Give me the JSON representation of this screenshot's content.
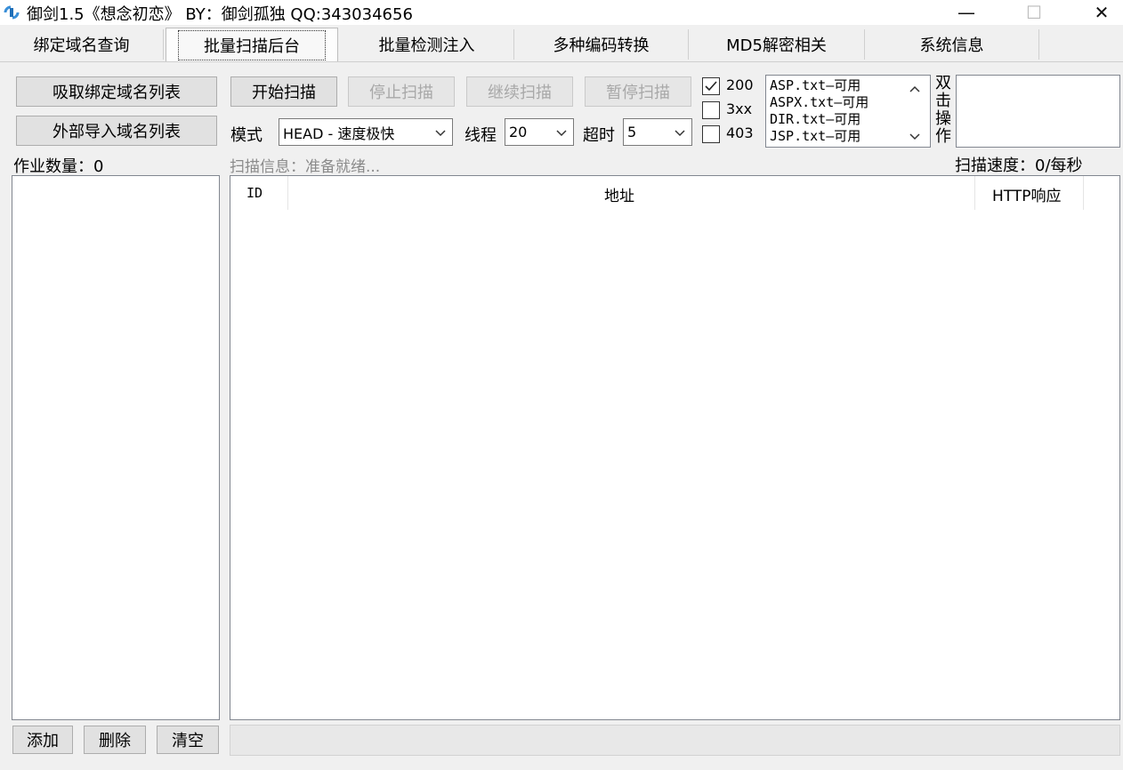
{
  "window": {
    "title": "御剑1.5《想念初恋》 BY：御剑孤独 QQ:343034656",
    "icon": "sword-app-icon",
    "controls": {
      "minimize": "—",
      "maximize": "☐",
      "close": "✕"
    }
  },
  "tabs": [
    {
      "label": "绑定域名查询",
      "active": false
    },
    {
      "label": "批量扫描后台",
      "active": true
    },
    {
      "label": "批量检测注入",
      "active": false
    },
    {
      "label": "多种编码转换",
      "active": false
    },
    {
      "label": "MD5解密相关",
      "active": false
    },
    {
      "label": "系统信息",
      "active": false
    }
  ],
  "left": {
    "fetch_button": "吸取绑定域名列表",
    "import_button": "外部导入域名列表",
    "job_count": "作业数量：0",
    "add_button": "添加",
    "delete_button": "删除",
    "clear_button": "清空"
  },
  "toolbar": {
    "start": "开始扫描",
    "stop": "停止扫描",
    "continue": "继续扫描",
    "pause": "暂停扫描",
    "mode_label": "模式",
    "mode_value": "HEAD - 速度极快",
    "threads_label": "线程",
    "threads_value": "20",
    "timeout_label": "超时",
    "timeout_value": "5"
  },
  "status_filters": [
    {
      "label": "200",
      "checked": true
    },
    {
      "label": "3xx",
      "checked": false
    },
    {
      "label": "403",
      "checked": false
    }
  ],
  "dictionaries": [
    "ASP.txt—可用",
    "ASPX.txt—可用",
    "DIR.txt—可用",
    "JSP.txt—可用"
  ],
  "double_click_label": "双击操作",
  "scan_info": "扫描信息：准备就绪...",
  "scan_speed": "扫描速度：0/每秒",
  "results_table": {
    "columns": [
      "ID",
      "地址",
      "HTTP响应"
    ],
    "rows": []
  }
}
